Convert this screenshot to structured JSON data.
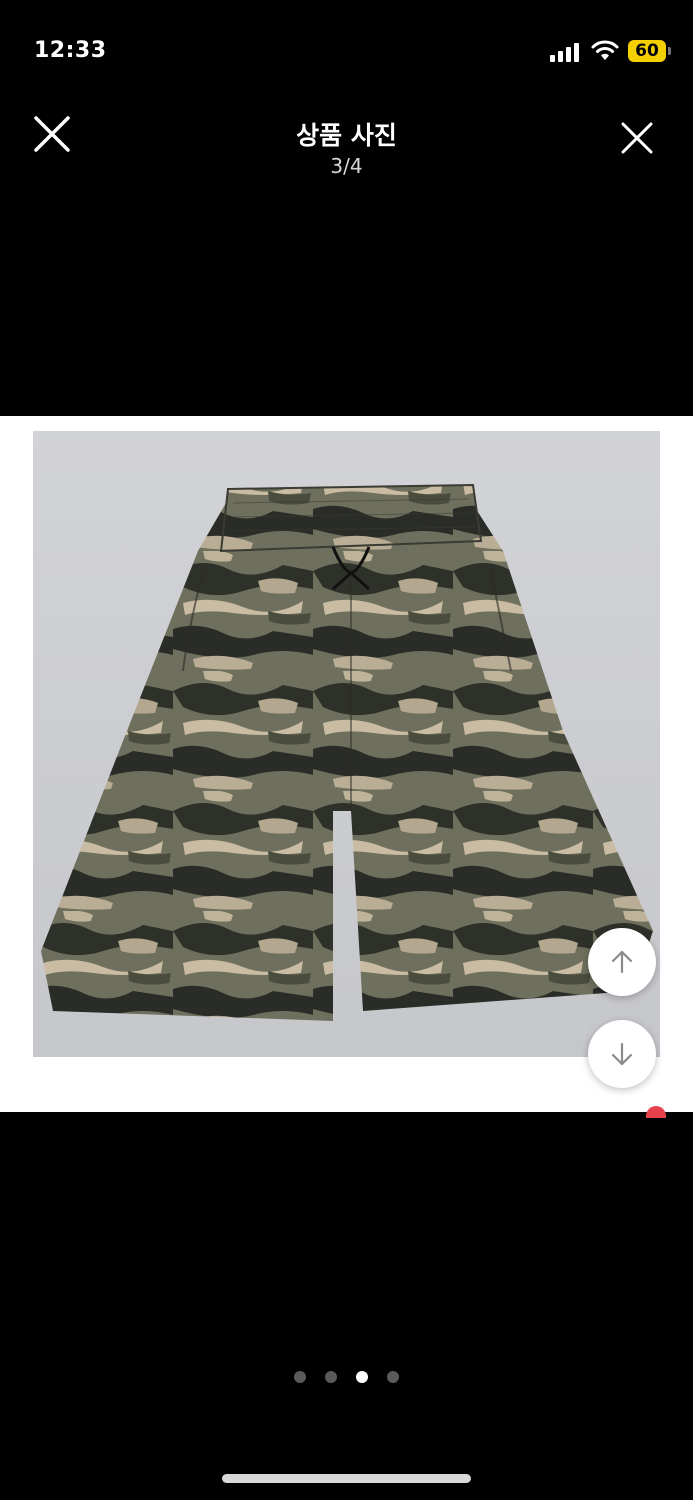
{
  "status_bar": {
    "time": "12:33",
    "battery": "60"
  },
  "header": {
    "title": "상품 사진",
    "counter": "3/4"
  },
  "gallery": {
    "total_pages": 4,
    "current_page": 3
  },
  "colors": {
    "background": "#000000",
    "photo_background": "#ffffff",
    "battery": "#f5d000",
    "active_dot": "#ffffff",
    "inactive_dot": "#5a5a5a"
  },
  "icons": {
    "close": "close-icon",
    "scroll_up": "arrow-up-icon",
    "scroll_down": "arrow-down-icon"
  }
}
